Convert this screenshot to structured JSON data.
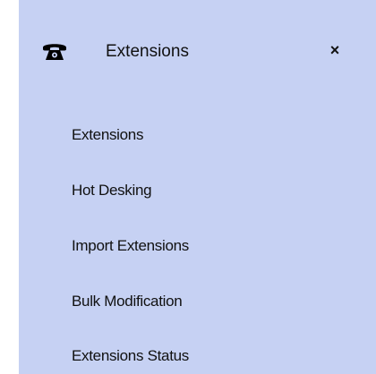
{
  "panel": {
    "background": "#c6d1f3",
    "header": {
      "icon": "telephone-icon",
      "title": "Extensions",
      "close_icon": "close-icon",
      "close_glyph": "×"
    },
    "menu": {
      "items": [
        {
          "label": "Extensions"
        },
        {
          "label": "Hot Desking"
        },
        {
          "label": "Import Extensions"
        },
        {
          "label": "Bulk Modification"
        },
        {
          "label": "Extensions Status"
        }
      ]
    }
  }
}
